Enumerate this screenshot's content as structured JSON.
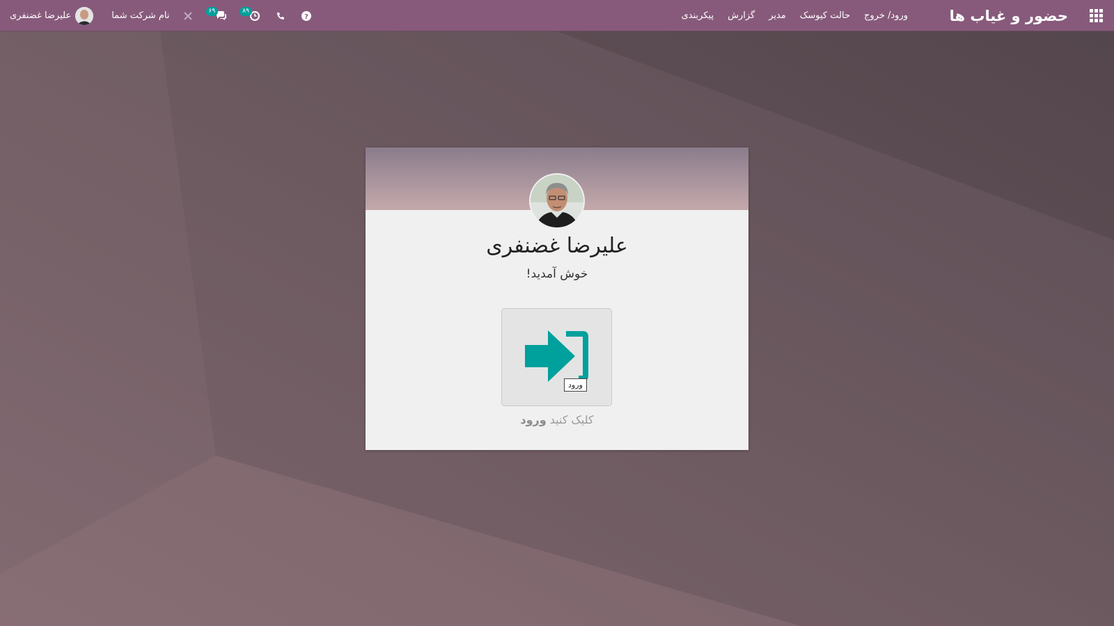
{
  "navbar": {
    "app_title": "حضور و غیاب ها",
    "menu": [
      "ورود/ خروج",
      "حالت کیوسک",
      "مدیر",
      "گزارش",
      "پیکربندی"
    ],
    "company": "نام شرکت شما",
    "user_name": "علیرضا غضنفری",
    "activity_count": "۸۹",
    "message_count": "۶۹",
    "icons": [
      "apps-icon",
      "help-icon",
      "phone-icon",
      "clock-icon",
      "chat-icon",
      "tools-icon"
    ]
  },
  "card": {
    "employee_name": "علیرضا غضنفری",
    "welcome": "خوش آمدید!",
    "tooltip": "ورود",
    "hint_prefix": "کلیک کنید",
    "hint_action": "ورود"
  },
  "colors": {
    "navbar": "#875a7b",
    "accent": "#00a09d",
    "background": "#6f5e69"
  }
}
